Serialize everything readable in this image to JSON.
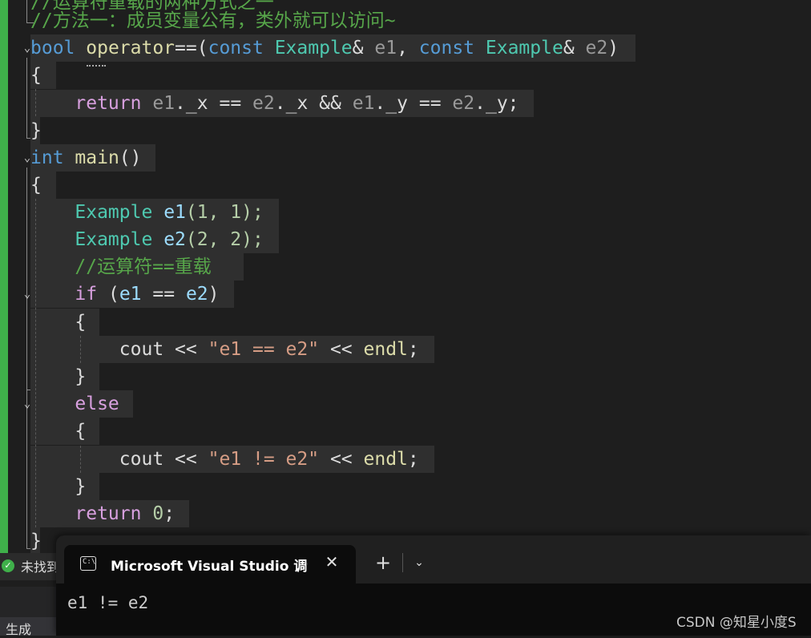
{
  "editor": {
    "partial_top_line": "//运算符重载的两种方式之一",
    "comment_method": "//方法一：成员变量公有，类外就可以访问~",
    "func_sig": {
      "kw_bool": "bool",
      "name": "operator",
      "op": "==",
      "open": "(",
      "kw_const1": "const",
      "type1": "Example",
      "amp1": "&",
      "param1": "e1",
      "comma": ",",
      "kw_const2": "const",
      "type2": "Example",
      "amp2": "&",
      "param2": "e2",
      "close": ")"
    },
    "brace_open": "{",
    "brace_close": "}",
    "return_stmt": {
      "kw": "return",
      "e1": "e1",
      "dot": ".",
      "x": "_x",
      "eq": "==",
      "e2": "e2",
      "and": "&&",
      "y": "_y",
      "semi": ";"
    },
    "main_sig": {
      "kw_int": "int",
      "name": "main",
      "parens": "()"
    },
    "decl1": {
      "type": "Example",
      "var": "e1",
      "args": "(1, 1);"
    },
    "decl2": {
      "type": "Example",
      "var": "e2",
      "args": "(2, 2);"
    },
    "comment_overload": "//运算符==重载",
    "if_stmt": {
      "kw": "if",
      "open": "(",
      "a": "e1",
      "op": "==",
      "b": "e2",
      "close": ")"
    },
    "cout1": {
      "cout": "cout",
      "shl": "<<",
      "str": "\"e1 == e2\"",
      "endl": "endl",
      "semi": ";"
    },
    "else_kw": "else",
    "cout2": {
      "cout": "cout",
      "shl": "<<",
      "str": "\"e1 != e2\"",
      "endl": "endl",
      "semi": ";"
    },
    "return0": {
      "kw": "return",
      "val": "0",
      "semi": ";"
    }
  },
  "status": {
    "text": "未找到相关问题",
    "icon": "check-circle-icon"
  },
  "bottom_panel": {
    "tab_label": "生成"
  },
  "terminal": {
    "tab_title": "Microsoft Visual Studio 调试控制台",
    "tab_icon": "console-icon",
    "output": "e1 != e2"
  },
  "watermark": "CSDN @知星小度S",
  "colors": {
    "keyword": "#569cd6",
    "control": "#d8a0df",
    "type": "#4ec9b0",
    "function": "#dcdcaa",
    "variable": "#9cdcfe",
    "number": "#b5cea8",
    "string": "#d69d85",
    "comment": "#57a64a",
    "change_bar": "#3fb04a"
  }
}
